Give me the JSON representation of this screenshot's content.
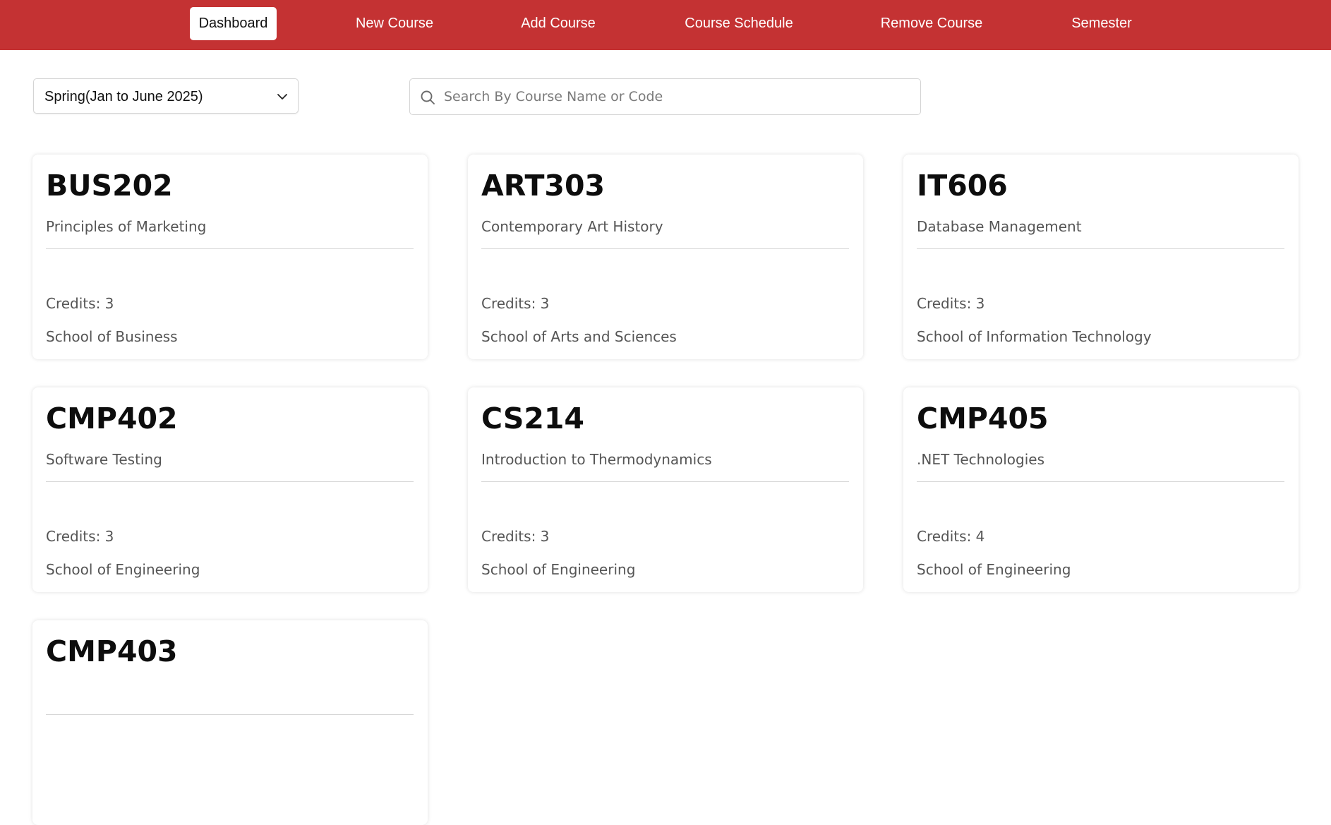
{
  "nav": {
    "items": [
      {
        "label": "Dashboard",
        "active": true
      },
      {
        "label": "New Course",
        "active": false
      },
      {
        "label": "Add Course",
        "active": false
      },
      {
        "label": "Course Schedule",
        "active": false
      },
      {
        "label": "Remove Course",
        "active": false
      },
      {
        "label": "Semester",
        "active": false
      }
    ]
  },
  "filters": {
    "semester_selected": "Spring(Jan to June 2025)",
    "search_placeholder": "Search By Course Name or Code",
    "search_value": ""
  },
  "courses": [
    {
      "code": "BUS202",
      "name": "Principles of Marketing",
      "credits": "Credits: 3",
      "school": "School of Business"
    },
    {
      "code": "ART303",
      "name": "Contemporary Art History",
      "credits": "Credits: 3",
      "school": "School of Arts and Sciences"
    },
    {
      "code": "IT606",
      "name": "Database Management",
      "credits": "Credits: 3",
      "school": "School of Information Technology"
    },
    {
      "code": "CMP402",
      "name": "Software Testing",
      "credits": "Credits: 3",
      "school": "School of Engineering"
    },
    {
      "code": "CS214",
      "name": "Introduction to Thermodynamics",
      "credits": "Credits: 3",
      "school": "School of Engineering"
    },
    {
      "code": "CMP405",
      "name": ".NET Technologies",
      "credits": "Credits: 4",
      "school": "School of Engineering"
    },
    {
      "code": "CMP403",
      "name": "",
      "credits": "",
      "school": ""
    }
  ],
  "colors": {
    "navbar": "#c43233",
    "nav_active_bg": "#ffffff"
  },
  "icons": {
    "dropdown": "chevron-down-icon",
    "search": "search-icon"
  }
}
